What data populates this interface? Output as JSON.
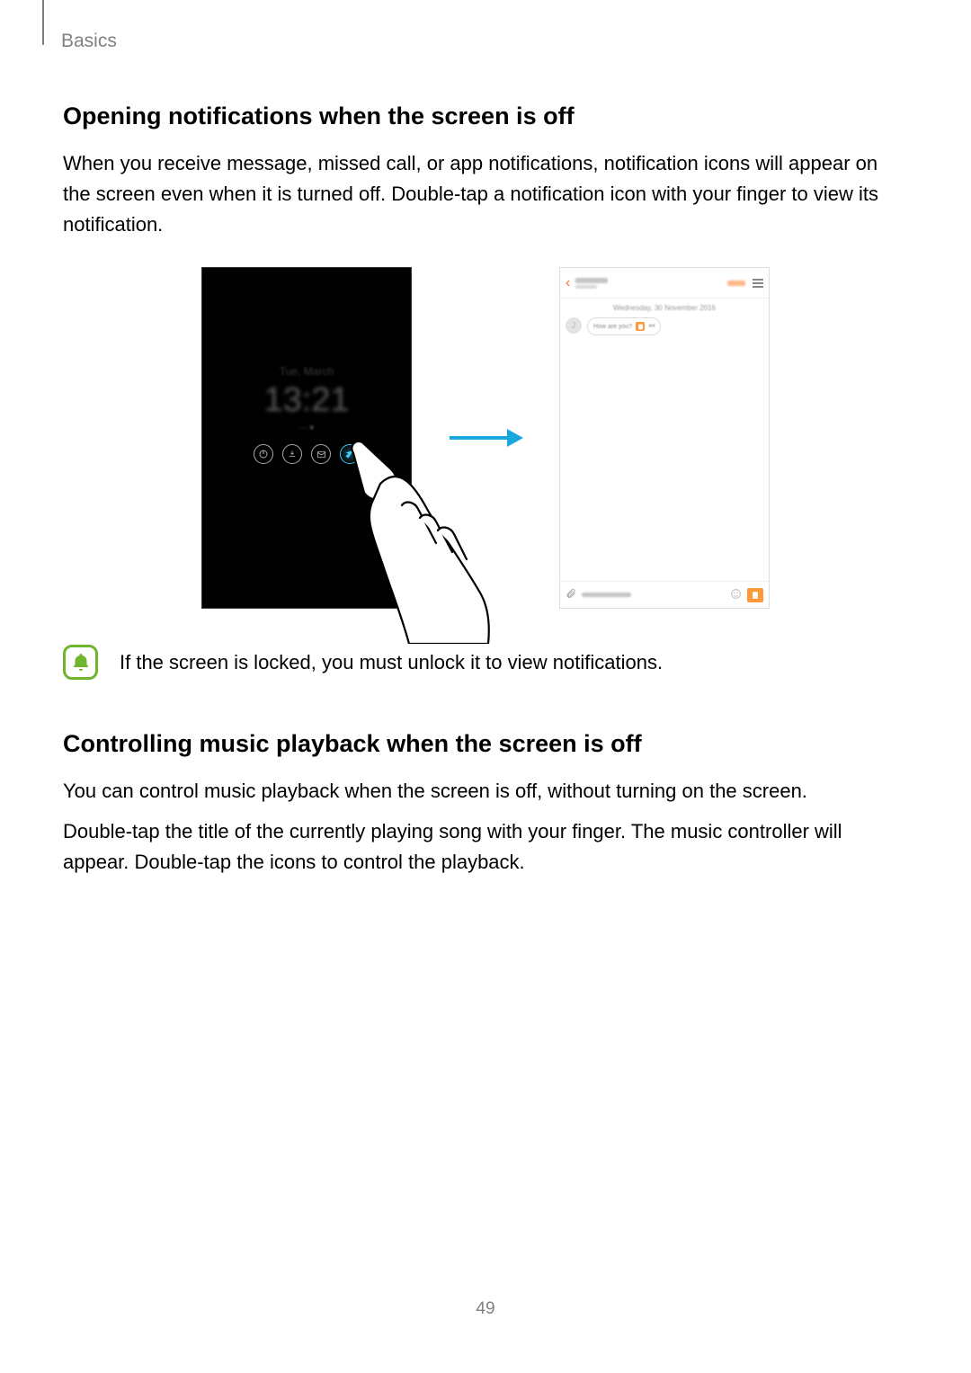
{
  "breadcrumb": "Basics",
  "section1": {
    "heading": "Opening notifications when the screen is off",
    "paragraph": "When you receive message, missed call, or app notifications, notification icons will appear on the screen even when it is turned off. Double-tap a notification icon with your finger to view its notification."
  },
  "figure": {
    "lock_day": "Tue, March",
    "lock_time": "13:21",
    "chat_date": "Wednesday, 30 November 2016",
    "chat_bubble_text": "How are you?"
  },
  "note": {
    "text": "If the screen is locked, you must unlock it to view notifications."
  },
  "section2": {
    "heading": "Controlling music playback when the screen is off",
    "paragraph1": "You can control music playback when the screen is off, without turning on the screen.",
    "paragraph2": "Double-tap the title of the currently playing song with your finger. The music controller will appear. Double-tap the icons to control the playback."
  },
  "page_number": "49"
}
